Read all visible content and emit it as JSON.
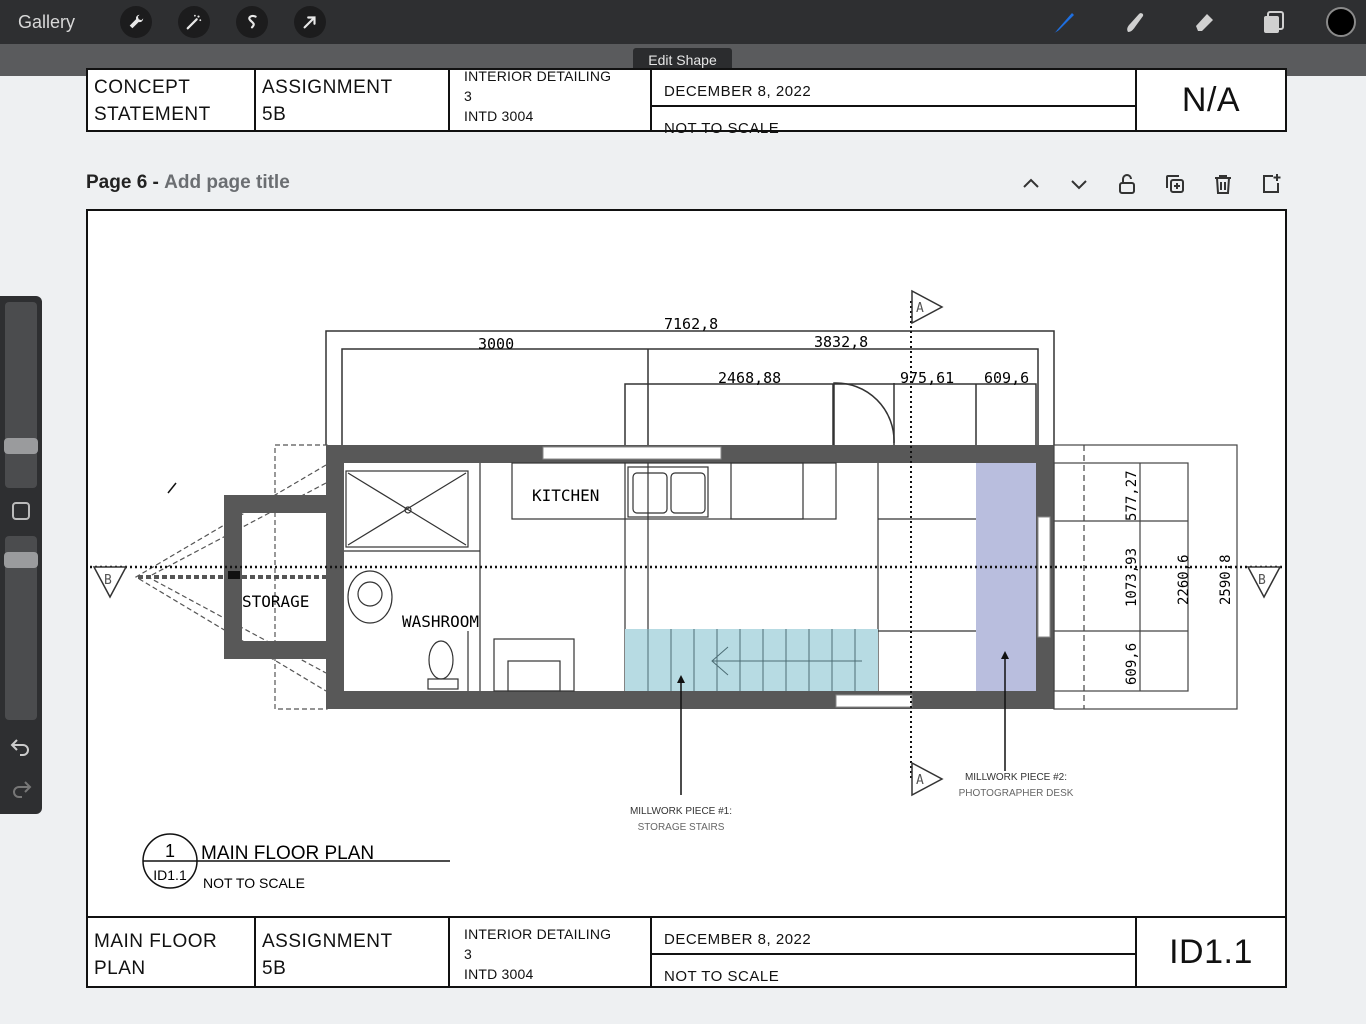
{
  "toolbar": {
    "gallery_label": "Gallery",
    "left_tools": [
      "wrench-icon",
      "magic-wand-icon",
      "selection-icon",
      "transform-arrow-icon"
    ],
    "right_tools": [
      "brush-icon",
      "smudge-icon",
      "eraser-icon",
      "layers-icon"
    ],
    "brush_color": "#1e6fe0",
    "current_color": "#000000"
  },
  "edit_shape_label": "Edit Shape",
  "top_title_block": {
    "col1": [
      "CONCEPT",
      "STATEMENT"
    ],
    "col2": [
      "ASSIGNMENT",
      "5B"
    ],
    "col3": [
      "INTERIOR DETAILING",
      "3",
      "INTD 3004"
    ],
    "date": "DECEMBER 8, 2022",
    "scale": "NOT TO SCALE",
    "sheet_no": "N/A"
  },
  "page": {
    "label": "Page 6 -",
    "title_placeholder": "Add page title"
  },
  "plan": {
    "dims": {
      "overall": "7162,8",
      "left": "3000",
      "right": "3832,8",
      "d1": "2468,88",
      "d2": "975,61",
      "d3": "609,6",
      "v1": "577,27",
      "v2": "1073,93",
      "v3": "609,6",
      "v4": "2260,6",
      "v5": "2590,8"
    },
    "rooms": {
      "kitchen": "KITCHEN",
      "storage": "STORAGE",
      "washroom": "WASHROOM"
    },
    "section_a": "A",
    "section_b": "B",
    "millwork1": [
      "MILLWORK PIECE #1:",
      "STORAGE STAIRS"
    ],
    "millwork2": [
      "MILLWORK PIECE #2:",
      "PHOTOGRAPHER DESK"
    ],
    "drawing_no": "1",
    "drawing_ref": "ID1.1",
    "drawing_title": "MAIN FLOOR PLAN",
    "drawing_scale": "NOT TO SCALE",
    "stair_color": "#b7dbe3",
    "desk_color": "#b9bede"
  },
  "bottom_title_block": {
    "col1": [
      "MAIN FLOOR",
      "PLAN"
    ],
    "col2": [
      "ASSIGNMENT",
      "5B"
    ],
    "col3": [
      "INTERIOR DETAILING",
      "3",
      "INTD 3004"
    ],
    "date": "DECEMBER 8, 2022",
    "scale": "NOT TO SCALE",
    "sheet_no": "ID1.1"
  }
}
